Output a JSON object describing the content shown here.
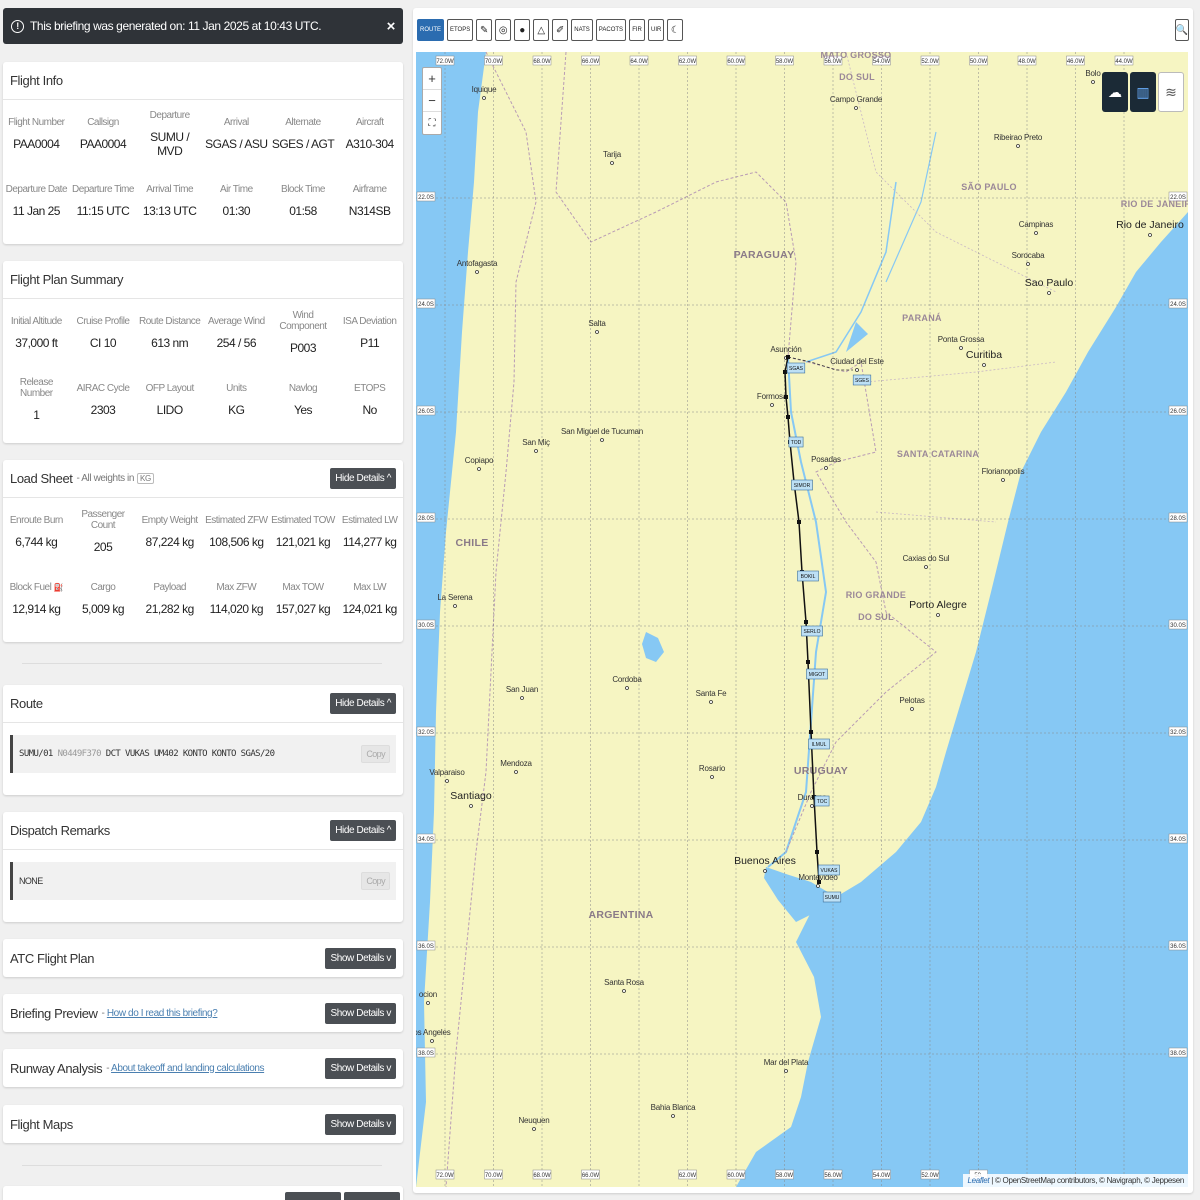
{
  "banner": {
    "text": "This briefing was generated on: 11 Jan 2025 at 10:43 UTC."
  },
  "flight_info": {
    "title": "Flight Info",
    "row1": [
      {
        "label": "Flight Number",
        "value": "PAA0004"
      },
      {
        "label": "Callsign",
        "value": "PAA0004"
      },
      {
        "label": "Departure",
        "value": "SUMU / MVD"
      },
      {
        "label": "Arrival",
        "value": "SGAS / ASU"
      },
      {
        "label": "Alternate",
        "value": "SGES / AGT"
      },
      {
        "label": "Aircraft",
        "value": "A310-304"
      }
    ],
    "row2": [
      {
        "label": "Departure Date",
        "value": "11 Jan 25"
      },
      {
        "label": "Departure Time",
        "value": "11:15 UTC"
      },
      {
        "label": "Arrival Time",
        "value": "13:13 UTC"
      },
      {
        "label": "Air Time",
        "value": "01:30"
      },
      {
        "label": "Block Time",
        "value": "01:58"
      },
      {
        "label": "Airframe",
        "value": "N314SB"
      }
    ]
  },
  "plan_summary": {
    "title": "Flight Plan Summary",
    "row1": [
      {
        "label": "Initial Altitude",
        "value": "37,000 ft"
      },
      {
        "label": "Cruise Profile",
        "value": "CI 10"
      },
      {
        "label": "Route Distance",
        "value": "613 nm"
      },
      {
        "label": "Average Wind",
        "value": "254 / 56"
      },
      {
        "label": "Wind Component",
        "value": "P003"
      },
      {
        "label": "ISA Deviation",
        "value": "P11"
      }
    ],
    "row2": [
      {
        "label": "Release Number",
        "value": "1"
      },
      {
        "label": "AIRAC Cycle",
        "value": "2303"
      },
      {
        "label": "OFP Layout",
        "value": "LIDO"
      },
      {
        "label": "Units",
        "value": "KG"
      },
      {
        "label": "Navlog",
        "value": "Yes"
      },
      {
        "label": "ETOPS",
        "value": "No"
      }
    ]
  },
  "load_sheet": {
    "title": "Load Sheet",
    "subtitle": "- All weights in",
    "unit_badge": "KG",
    "button": "Hide Details ^",
    "row1": [
      {
        "label": "Enroute Burn",
        "value": "6,744 kg"
      },
      {
        "label": "Passenger Count",
        "value": "205"
      },
      {
        "label": "Empty Weight",
        "value": "87,224 kg"
      },
      {
        "label": "Estimated ZFW",
        "value": "108,506 kg"
      },
      {
        "label": "Estimated TOW",
        "value": "121,021 kg"
      },
      {
        "label": "Estimated LW",
        "value": "114,277 kg"
      }
    ],
    "row2": [
      {
        "label": "Block Fuel",
        "value": "12,914 kg"
      },
      {
        "label": "Cargo",
        "value": "5,009 kg"
      },
      {
        "label": "Payload",
        "value": "21,282 kg"
      },
      {
        "label": "Max ZFW",
        "value": "114,020 kg"
      },
      {
        "label": "Max TOW",
        "value": "157,027 kg"
      },
      {
        "label": "Max LW",
        "value": "124,021 kg"
      }
    ]
  },
  "route": {
    "title": "Route",
    "button": "Hide Details ^",
    "origin": "SUMU/01",
    "speed_level": "N0449F370",
    "rest": "DCT VUKAS UM402 KONTO KONTO SGAS/20",
    "copy": "Copy"
  },
  "remarks": {
    "title": "Dispatch Remarks",
    "button": "Hide Details ^",
    "text": "NONE",
    "copy": "Copy"
  },
  "collapsed": [
    {
      "title": "ATC Flight Plan",
      "link": "",
      "button": "Show Details v"
    },
    {
      "title": "Briefing Preview",
      "link": "How do I read this briefing?",
      "button": "Show Details v"
    },
    {
      "title": "Runway Analysis",
      "link": "About takeoff and landing calculations",
      "button": "Show Details v"
    },
    {
      "title": "Flight Maps",
      "link": "",
      "button": "Show Details v"
    }
  ],
  "toolbar": {
    "buttons": [
      "ROUTE",
      "ETOPS",
      "✎",
      "◎",
      "●",
      "△",
      "✐",
      "NATS",
      "PACOTS",
      "FIR",
      "UIR",
      "☾"
    ],
    "active": "ROUTE",
    "search_icon": "🔍"
  },
  "map": {
    "attribution_leaflet": "Leaflet",
    "attribution_text": "| © OpenStreetMap contributors, © Navigraph, © Jeppesen",
    "lon_labels_top": [
      "72.0W",
      "70.0W",
      "68.0W",
      "66.0W",
      "64.0W",
      "62.0W",
      "60.0W",
      "58.0W",
      "56.0W",
      "54.0W",
      "52.0W",
      "50.0W",
      "48.0W",
      "46.0W",
      "44.0W"
    ],
    "lon_labels_bottom": [
      "72.0W",
      "70.0W",
      "68.0W",
      "66.0W",
      "62.0W",
      "60.0W",
      "58.0W",
      "56.0W",
      "54.0W",
      "52.0W",
      "50."
    ],
    "lat_labels": [
      "22.0S",
      "24.0S",
      "26.0S",
      "28.0S",
      "30.0S",
      "32.0S",
      "34.0S",
      "36.0S",
      "38.0S"
    ],
    "countries": [
      "PARAGUAY",
      "CHILE",
      "ARGENTINA",
      "URUGUAY"
    ],
    "states": [
      "MATO GROSSO",
      "DO SUL",
      "SÃO PAULO",
      "PARANÁ",
      "SANTA CATARINA",
      "RIO GRANDE",
      "DO SUL",
      "RIO DE JANEIR"
    ],
    "cities": [
      "Iquique",
      "Campo Grande",
      "Tarija",
      "Ribeirao Preto",
      "Campinas",
      "Antofagasta",
      "Sorocaba",
      "Salta",
      "Ponta Grossa",
      "Asunción",
      "Ciudad del Este",
      "Formosa",
      "San Miç",
      "San Miguel de Tucuman",
      "Posadas",
      "Copiapo",
      "Florianopolis",
      "Caxias do Sul",
      "La Serena",
      "San Juan",
      "Cordoba",
      "Santa Fe",
      "Pelotas",
      "Mendoza",
      "Rosario",
      "Valparaiso",
      "Durazno",
      "Montevideo",
      "Santa Rosa",
      "ocion",
      "os Angeles",
      "Mar del Plata",
      "Bahia Blanca",
      "Neuquen",
      "Bolo"
    ],
    "big_cities": [
      "Rio de Janeiro",
      "Sao Paulo",
      "Curitiba",
      "Porto Alegre",
      "Santiago",
      "Buenos Aires"
    ],
    "waypoints": [
      "SGAS",
      "SGES",
      "TOD",
      "SIMOR",
      "BOKIL",
      "SERLO",
      "MIGOT",
      "ILMUL",
      "TOC",
      "VUKAS",
      "SUMU"
    ]
  }
}
